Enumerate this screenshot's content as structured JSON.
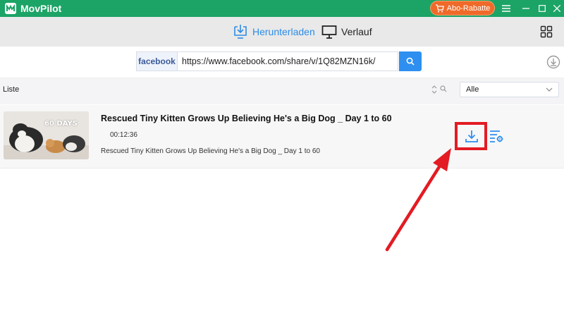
{
  "app": {
    "title": "MovPilot",
    "promo_label": "Abo-Rabatte"
  },
  "tabs": [
    {
      "label": "Herunterladen",
      "icon": "download-monitor-icon",
      "active": true
    },
    {
      "label": "Verlauf",
      "icon": "monitor-icon",
      "active": false
    }
  ],
  "search": {
    "source_label": "facebook",
    "url_value": "https://www.facebook.com/share/v/1Q82MZN16k/"
  },
  "list": {
    "label": "Liste",
    "filter_value": "Alle"
  },
  "items": [
    {
      "thumbnail_text": "60 DAYS",
      "title": "Rescued Tiny Kitten Grows Up Believing He's a Big Dog _ Day 1 to 60",
      "duration": "00:12:36",
      "description": "Rescued Tiny Kitten Grows Up Believing He's a Big Dog _ Day 1 to 60"
    }
  ],
  "colors": {
    "titlebar": "#1ba466",
    "accent": "#2e8ff0",
    "promo": "#ef6a2a",
    "highlight": "#e31b23"
  }
}
